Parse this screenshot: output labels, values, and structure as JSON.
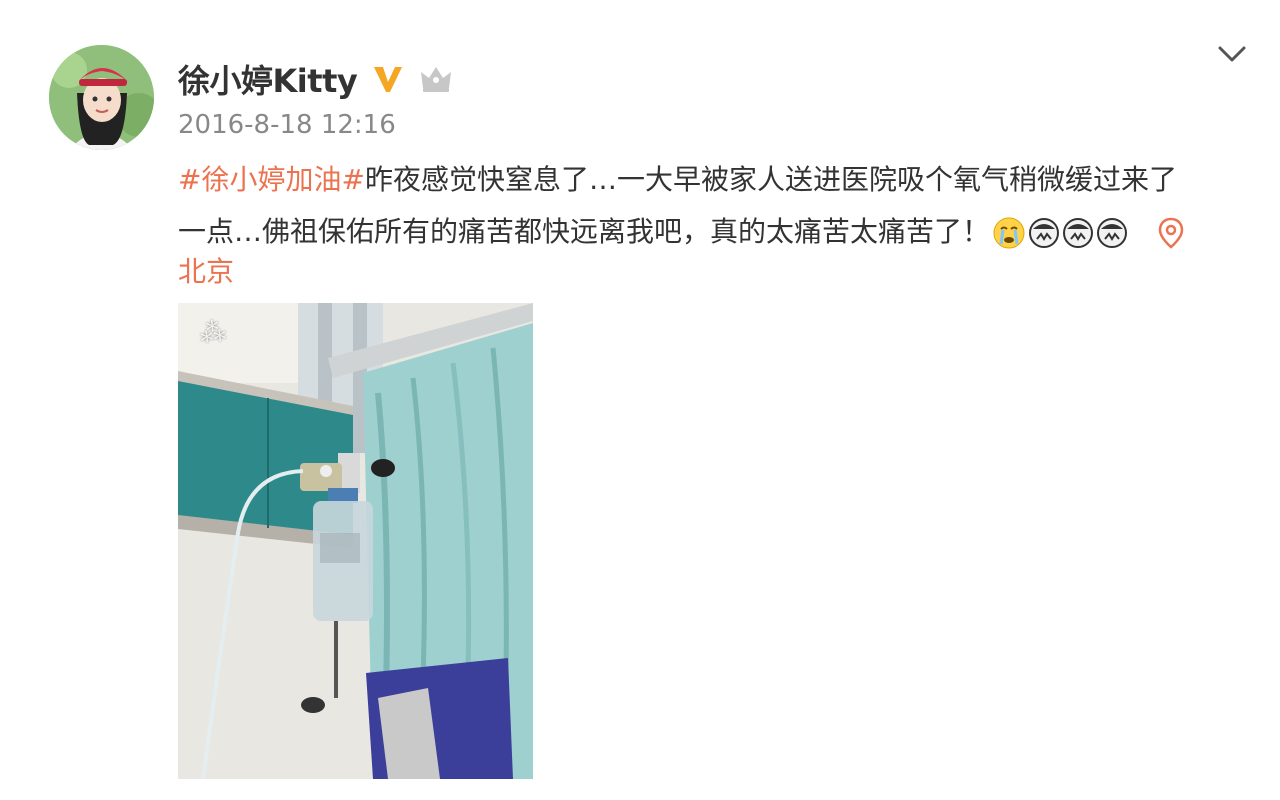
{
  "post": {
    "author_name": "徐小婷Kitty",
    "timestamp": "2016-8-18 12:16",
    "topic": "#徐小婷加油#",
    "text_line1": "昨夜感觉快窒息了…一大早被家人送进医院吸个氧气稍微缓过来了",
    "text_line2": "一点…佛祖保佑所有的痛苦都快远离我吧，真的太痛苦太痛苦了！",
    "location": "北京"
  },
  "icons": {
    "verified": "verified-v-icon",
    "member": "crown-icon",
    "more": "chevron-down-icon",
    "location": "location-pin-icon",
    "emoji": [
      "crying-emoji-icon",
      "sad-emoji-icon",
      "sad-emoji-icon",
      "sad-emoji-icon"
    ]
  },
  "colors": {
    "accent": "#eb7350",
    "verified": "#f5a623",
    "text": "#333333",
    "muted": "#888888"
  }
}
